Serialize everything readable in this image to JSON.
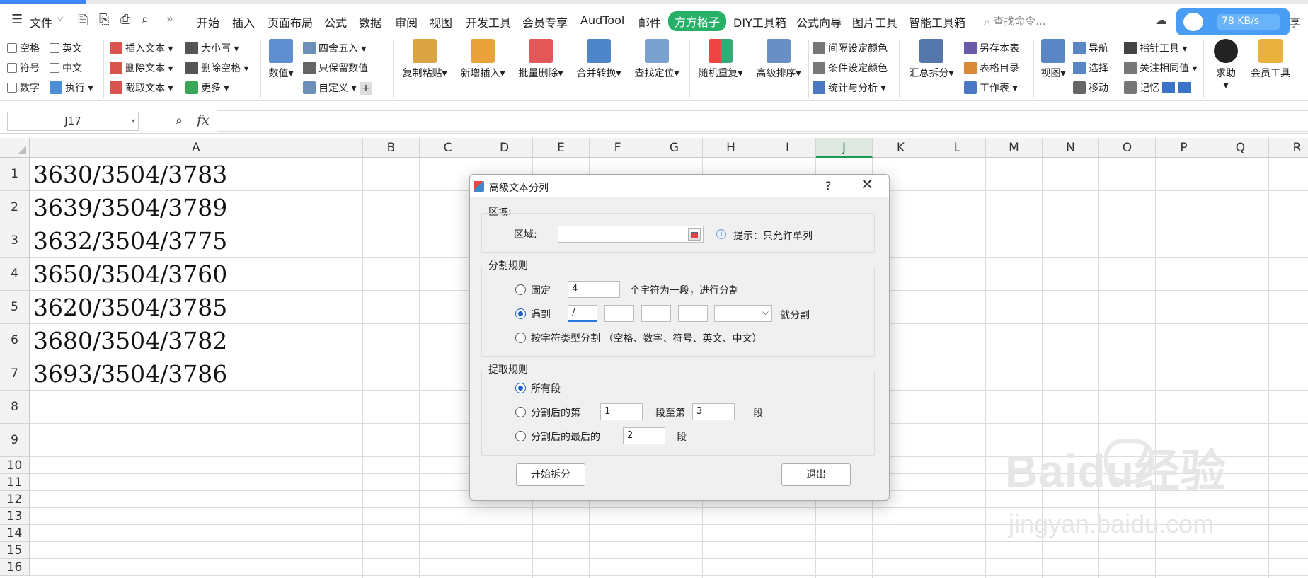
{
  "menu": {
    "file": "文件",
    "tabs": [
      "开始",
      "插入",
      "页面布局",
      "公式",
      "数据",
      "审阅",
      "视图",
      "开发工具",
      "会员专享",
      "AudTool",
      "邮件",
      "方方格子",
      "DIY工具箱",
      "公式向导",
      "图片工具",
      "智能工具箱"
    ],
    "active_tab": "方方格子",
    "search_placeholder": "查找命令...",
    "share": "享"
  },
  "speed_widget": {
    "label": "78 KB/s"
  },
  "ribbon": {
    "check_space": "空格",
    "check_english": "英文",
    "check_symbol": "符号",
    "check_chinese": "中文",
    "check_number": "数字",
    "execute": "执行",
    "insert_text": "插入文本",
    "delete_text": "删除文本",
    "extract_text": "截取文本",
    "case": "大小写",
    "delete_space": "删除空格",
    "more": "更多",
    "numeric": "数值",
    "round": "四舍五入",
    "keep_value": "只保留数值",
    "custom": "自定义",
    "copy_paste": "复制粘贴",
    "new_insert": "新增插入",
    "batch_delete": "批量删除",
    "merge_convert": "合并转换",
    "find_locate": "查找定位",
    "random_repeat": "随机重复",
    "advanced_sort": "高级排序",
    "interval_color": "间隔设定颜色",
    "cond_color": "条件设定颜色",
    "stats": "统计与分析",
    "summary_split": "汇总拆分",
    "save_as_sheet": "另存本表",
    "sheet_toc": "表格目录",
    "worksheet": "工作表",
    "view": "视图",
    "navigate": "导航",
    "select": "选择",
    "move": "移动",
    "pointer_tool": "指针工具",
    "focus_same": "关注相同值",
    "memory": "记忆",
    "help": "求助",
    "member_tools": "会员工具"
  },
  "formula_bar": {
    "name_box": "J17",
    "fx": "fx",
    "formula": ""
  },
  "sheet": {
    "columns": [
      "A",
      "B",
      "C",
      "D",
      "E",
      "F",
      "G",
      "H",
      "I",
      "J",
      "K",
      "L",
      "M",
      "N",
      "O",
      "P",
      "Q",
      "R"
    ],
    "selected_column": "J",
    "rows": [
      "1",
      "2",
      "3",
      "4",
      "5",
      "6",
      "7",
      "8",
      "9",
      "10",
      "11",
      "12",
      "13",
      "14",
      "15",
      "16"
    ],
    "cells_A": [
      "3630/3504/3783",
      "3639/3504/3789",
      "3632/3504/3775",
      "3650/3504/3760",
      "3620/3504/3785",
      "3680/3504/3782",
      "3693/3504/3786"
    ]
  },
  "watermark": {
    "logo": "Baidu经验",
    "url": "jingyan.baidu.com"
  },
  "dialog": {
    "title": "高级文本分列",
    "help": "?",
    "close": "✕",
    "region_group": "区域:",
    "region_label": "区域:",
    "region_value": "",
    "region_hint": "提示：只允许单列",
    "split_group": "分割规则",
    "fixed_label": "固定",
    "fixed_value": "4",
    "fixed_suffix": "个字符为一段，进行分割",
    "meet_label": "遇到",
    "meet_values": [
      "/",
      "",
      "",
      ""
    ],
    "meet_combo": "",
    "meet_suffix": "就分割",
    "bytype_label": "按字符类型分割 （空格、数字、符号、英文、中文）",
    "extract_group": "提取规则",
    "all_label": "所有段",
    "after_label": "分割后的第",
    "after_from": "1",
    "to_label": "段至第",
    "after_to": "3",
    "seg_label": "段",
    "last_label": "分割后的最后的",
    "last_value": "2",
    "seg_label2": "段",
    "start_button": "开始拆分",
    "exit_button": "退出",
    "selected_split_rule": "遇到",
    "selected_extract_rule": "所有段"
  }
}
